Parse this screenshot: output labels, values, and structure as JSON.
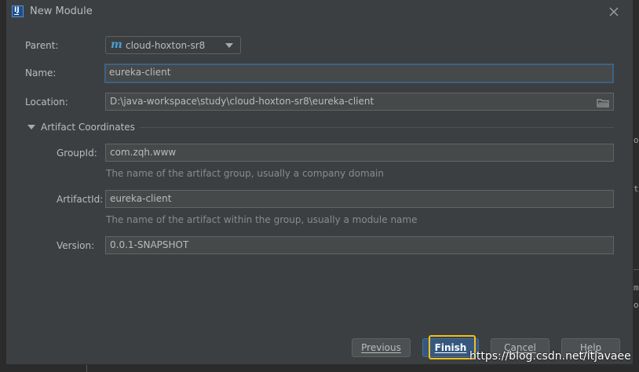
{
  "dialog": {
    "title": "New Module",
    "icon": "intellij-app-icon",
    "icon_glyph": "IJ"
  },
  "form": {
    "parent": {
      "label": "Parent:",
      "value": "cloud-hoxton-sr8",
      "icon": "module-icon",
      "icon_glyph": "m"
    },
    "name": {
      "label": "Name:",
      "value": "eureka-client"
    },
    "location": {
      "label": "Location:",
      "value": "D:\\java-workspace\\study\\cloud-hoxton-sr8\\eureka-client",
      "icon": "folder-icon"
    },
    "artifact_section": {
      "title": "Artifact Coordinates",
      "expanded": true,
      "group_id": {
        "label": "GroupId:",
        "value": "com.zqh.www",
        "hint": "The name of the artifact group, usually a company domain"
      },
      "artifact_id": {
        "label": "ArtifactId:",
        "value": "eureka-client",
        "hint": "The name of the artifact within the group, usually a module name"
      },
      "version": {
        "label": "Version:",
        "value": "0.0.1-SNAPSHOT"
      }
    }
  },
  "buttons": {
    "previous": "Previous",
    "finish": "Finish",
    "cancel": "Cancel",
    "help": "Help"
  },
  "watermark": "https://blog.csdn.net/itjavaee",
  "background": {
    "fragments": [
      "or",
      "te",
      "-",
      "m",
      "ot"
    ]
  },
  "colors": {
    "dialog_bg": "#3c3f41",
    "field_bg": "#45494a",
    "focus_border": "#3d6185",
    "primary_button": "#365880",
    "highlight": "#f0c020"
  }
}
